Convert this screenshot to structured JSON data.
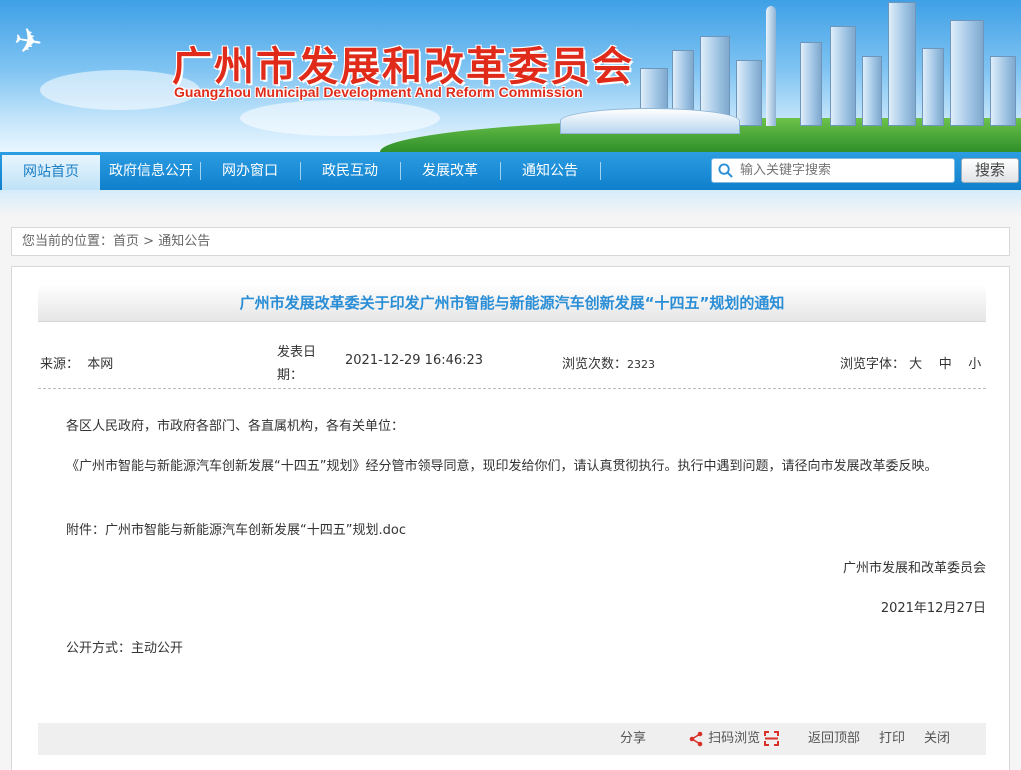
{
  "header": {
    "logo_cn": "广州市发展和改革委员会",
    "logo_en": "Guangzhou Municipal Development And Reform Commission"
  },
  "nav": {
    "items": [
      {
        "label": "网站首页",
        "active": true
      },
      {
        "label": "政府信息公开"
      },
      {
        "label": "网办窗口"
      },
      {
        "label": "政民互动"
      },
      {
        "label": "发展改革"
      },
      {
        "label": "通知公告"
      }
    ],
    "search_placeholder": "输入关键字搜索",
    "search_button": "搜索"
  },
  "breadcrumb": {
    "prefix": "您当前的位置：",
    "home": "首页",
    "sep": ">",
    "current": "通知公告"
  },
  "article": {
    "title": "广州市发展改革委关于印发广州市智能与新能源汽车创新发展“十四五”规划的通知",
    "source_label": "来源：",
    "source_value": "本网",
    "date_label": "发表日期：",
    "date_value": "2021-12-29 16:46:23",
    "views_label": "浏览次数：",
    "views_value": "2323",
    "font_label": "浏览字体：",
    "font_large": "大",
    "font_medium": "中",
    "font_small": "小",
    "salutation": "各区人民政府，市政府各部门、各直属机构，各有关单位：",
    "body": "《广州市智能与新能源汽车创新发展“十四五”规划》经分管市领导同意，现印发给你们，请认真贯彻执行。执行中遇到问题，请径向市发展改革委反映。",
    "attachment_label": "附件：",
    "attachment_link": "广州市智能与新能源汽车创新发展“十四五”规划.doc",
    "signature": "广州市发展和改革委员会",
    "sign_date": "2021年12月27日",
    "disclosure": "公开方式：主动公开"
  },
  "footer": {
    "share": "分享",
    "scan": "扫码浏览",
    "back_top": "返回顶部",
    "print": "打印",
    "close": "关闭"
  },
  "colors": {
    "nav_blue": "#0f7fcc",
    "title_blue": "#2a8ed6",
    "logo_red": "#e02b1b",
    "share_red": "#d9302a"
  }
}
